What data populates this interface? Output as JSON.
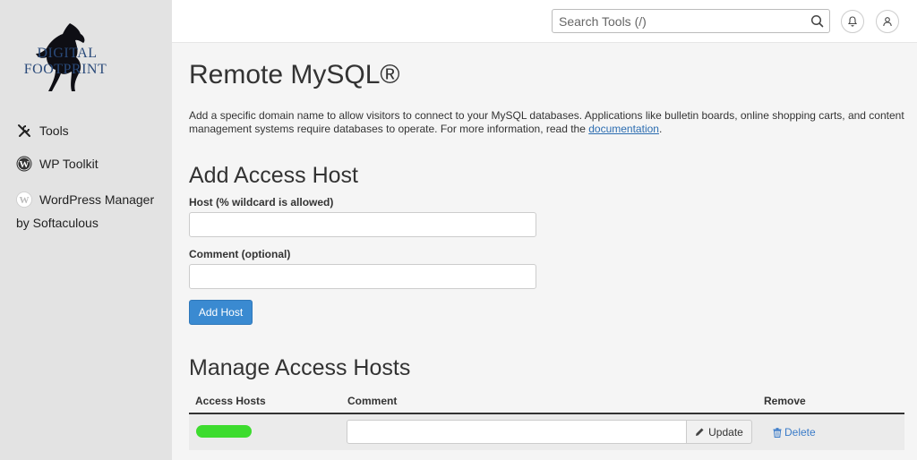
{
  "sidebar": {
    "logo_line1": "DIGITAL",
    "logo_line2": "FOOTPRINT",
    "items": [
      {
        "label": "Tools",
        "icon": "tools-icon"
      },
      {
        "label": "WP Toolkit",
        "icon": "wordpress-icon"
      },
      {
        "label": "WordPress Manager",
        "label2": "by Softaculous",
        "icon": "wordpress-icon"
      }
    ]
  },
  "header": {
    "search_placeholder": "Search Tools (/)"
  },
  "main": {
    "title": "Remote MySQL®",
    "description": "Add a specific domain name to allow visitors to connect to your MySQL databases. Applications like bulletin boards, online shopping carts, and content management systems require databases to operate. For more information, read the ",
    "doc_link": "documentation",
    "desc_end": ".",
    "add_heading": "Add Access Host",
    "host_label": "Host (% wildcard is allowed)",
    "comment_label": "Comment (optional)",
    "add_button": "Add Host",
    "manage_heading": "Manage Access Hosts",
    "table": {
      "headers": [
        "Access Hosts",
        "Comment",
        "Remove"
      ],
      "update_label": "Update",
      "delete_label": "Delete"
    }
  },
  "colors": {
    "primary": "#3a8ad1",
    "link": "#3a7bc8",
    "sidebar_bg": "#e3e3e3",
    "redaction": "#3ddc2e"
  }
}
